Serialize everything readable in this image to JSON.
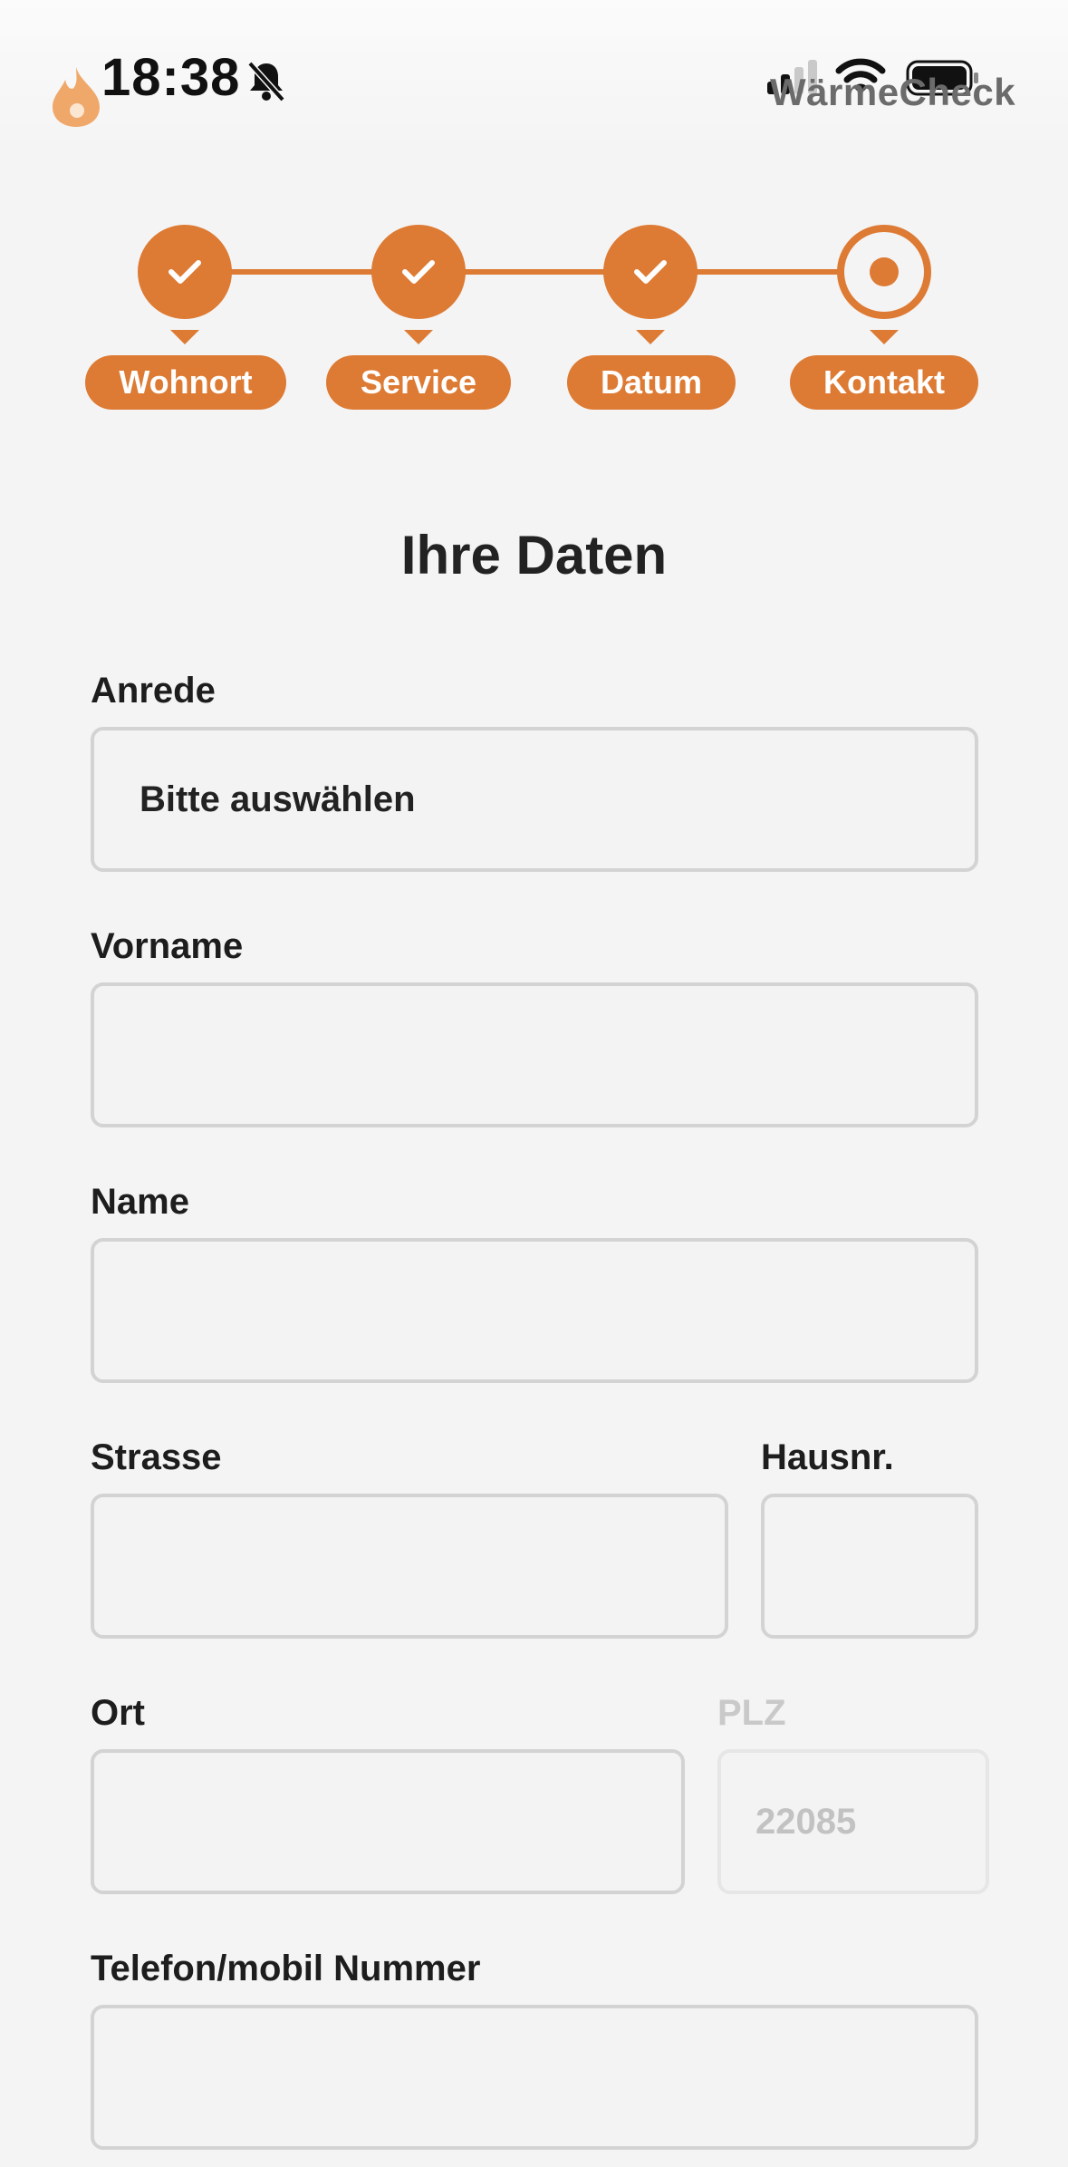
{
  "status_bar": {
    "time": "18:38",
    "brand": "WärmeCheck",
    "icons": [
      "flame-logo-icon",
      "bell-slash-icon",
      "cellular-signal-icon",
      "wifi-icon",
      "battery-icon"
    ]
  },
  "stepper": {
    "accent_color": "#dd7a33",
    "steps": [
      {
        "label": "Wohnort",
        "state": "done"
      },
      {
        "label": "Service",
        "state": "done"
      },
      {
        "label": "Datum",
        "state": "done"
      },
      {
        "label": "Kontakt",
        "state": "current"
      }
    ]
  },
  "form": {
    "title": "Ihre Daten",
    "anrede": {
      "label": "Anrede",
      "value": "Bitte auswählen"
    },
    "vorname": {
      "label": "Vorname",
      "value": ""
    },
    "name": {
      "label": "Name",
      "value": ""
    },
    "strasse": {
      "label": "Strasse",
      "value": ""
    },
    "hausnr": {
      "label": "Hausnr.",
      "value": ""
    },
    "ort": {
      "label": "Ort",
      "value": ""
    },
    "plz": {
      "label": "PLZ",
      "value": "22085",
      "disabled": true
    },
    "telefon": {
      "label": "Telefon/mobil Nummer",
      "value": ""
    }
  }
}
